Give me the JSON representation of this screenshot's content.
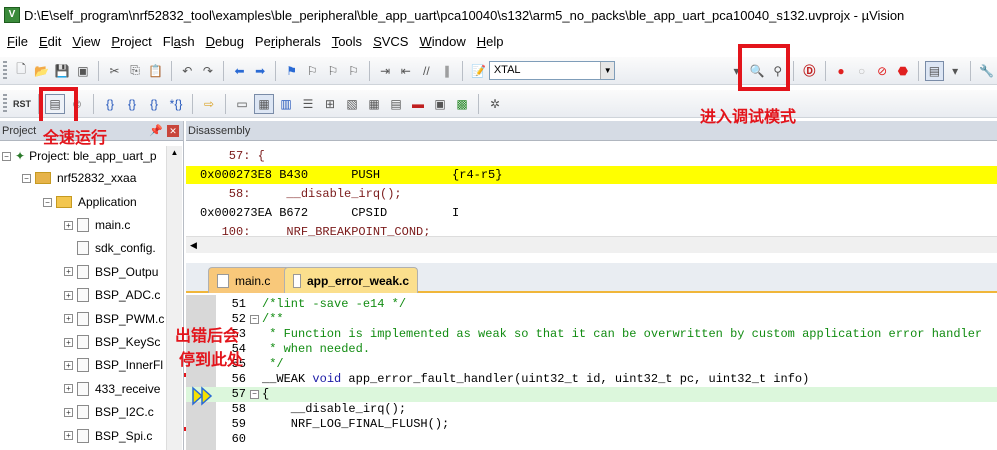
{
  "window": {
    "title": "D:\\E\\self_program\\nrf52832_tool\\examples\\ble_peripheral\\ble_app_uart\\pca10040\\s132\\arm5_no_packs\\ble_app_uart_pca10040_s132.uvprojx - µVision"
  },
  "menu": [
    {
      "label": "File",
      "key": "F",
      "rest": "ile"
    },
    {
      "label": "Edit",
      "key": "E",
      "rest": "dit"
    },
    {
      "label": "View",
      "key": "V",
      "rest": "iew"
    },
    {
      "label": "Project",
      "key": "P",
      "rest": "roject"
    },
    {
      "label": "Flash",
      "key": "a",
      "pre": "Fl",
      "rest": "sh"
    },
    {
      "label": "Debug",
      "key": "D",
      "rest": "ebug"
    },
    {
      "label": "Peripherals",
      "key": "r",
      "pre": "Pe",
      "rest": "ipherals"
    },
    {
      "label": "Tools",
      "key": "T",
      "rest": "ools"
    },
    {
      "label": "SVCS",
      "key": "S",
      "rest": "VCS"
    },
    {
      "label": "Window",
      "key": "W",
      "rest": "indow"
    },
    {
      "label": "Help",
      "key": "H",
      "rest": "elp"
    }
  ],
  "toolbar": {
    "target": "XTAL",
    "rst_label": "RST"
  },
  "annotations": {
    "debug_mode": "进入调试模式",
    "full_run": "全速运行",
    "stops_here_line1": "出错后会",
    "stops_here_line2": "停到此处"
  },
  "project": {
    "header": "Project",
    "root": "Project: ble_app_uart_p",
    "target": "nrf52832_xxaa",
    "group": "Application",
    "files": [
      "main.c",
      "sdk_config.",
      "BSP_Outpu",
      "BSP_ADC.c",
      "BSP_PWM.c",
      "BSP_KeySc",
      "BSP_InnerFl",
      "433_receive",
      "BSP_I2C.c",
      "BSP_Spi.c"
    ]
  },
  "disassembly": {
    "header": "Disassembly",
    "lines": [
      {
        "text": "    57: {",
        "highlight": false
      },
      {
        "text": "0x000273E8 B430      PUSH          {r4-r5}",
        "highlight": true
      },
      {
        "text": "    58:     __disable_irq();",
        "highlight": false
      },
      {
        "text": "0x000273EA B672      CPSID         I",
        "highlight": false
      },
      {
        "text": "   100:     NRF_BREAKPOINT_COND;",
        "highlight": false
      }
    ]
  },
  "tabs": [
    {
      "label": "main.c",
      "active": false
    },
    {
      "label": "app_error_weak.c",
      "active": true
    }
  ],
  "editor": {
    "lines": [
      {
        "no": "51",
        "text": "/*lint -save -e14 */"
      },
      {
        "no": "52",
        "text": "/**"
      },
      {
        "no": "53",
        "text": " * Function is implemented as weak so that it can be overwritten by custom application error handler"
      },
      {
        "no": "54",
        "text": " * when needed."
      },
      {
        "no": "55",
        "text": " */"
      },
      {
        "no": "56",
        "text": "__WEAK void app_error_fault_handler(uint32_t id, uint32_t pc, uint32_t info)"
      },
      {
        "no": "57",
        "text": "{"
      },
      {
        "no": "58",
        "text": "    __disable_irq();"
      },
      {
        "no": "59",
        "text": "    NRF_LOG_FINAL_FLUSH();"
      },
      {
        "no": "60",
        "text": ""
      }
    ]
  },
  "colors": {
    "annotation": "#e3141b",
    "highlight": "#ffff00",
    "comment": "#128c12"
  }
}
